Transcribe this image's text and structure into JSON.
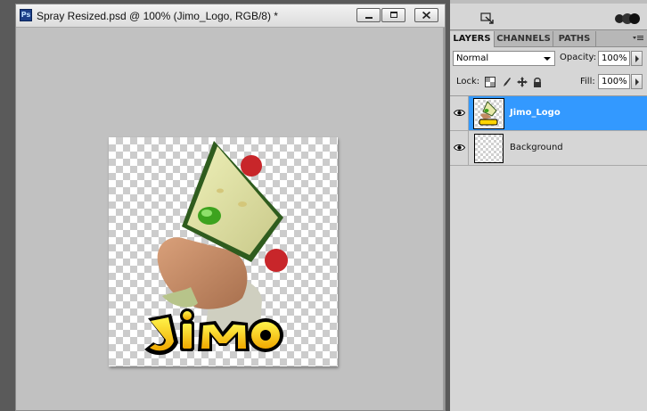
{
  "document": {
    "title": "Spray Resized.psd @ 100% (Jimo_Logo, RGB/8) *",
    "app_badge": "Ps",
    "logo_text": "Jimo"
  },
  "layers_panel": {
    "tabs": [
      {
        "label": "LAYERS",
        "active": true
      },
      {
        "label": "CHANNELS",
        "active": false
      },
      {
        "label": "PATHS",
        "active": false
      }
    ],
    "blend_mode": "Normal",
    "opacity_label": "Opacity:",
    "opacity_value": "100%",
    "lock_label": "Lock:",
    "fill_label": "Fill:",
    "fill_value": "100%",
    "layers": [
      {
        "name": "Jimo_Logo",
        "visible": true,
        "selected": true
      },
      {
        "name": "Background",
        "visible": true,
        "selected": false
      }
    ]
  },
  "colors": {
    "selection": "#3399ff",
    "logo_yellow": "#ffd400"
  }
}
